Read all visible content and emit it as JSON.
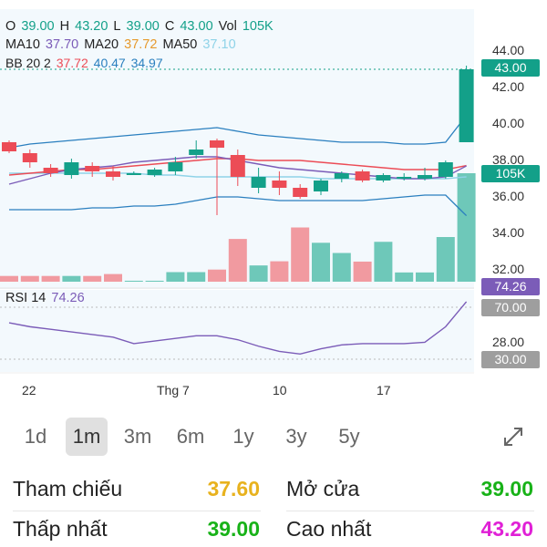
{
  "legend": {
    "ohlc": [
      {
        "k": "O",
        "v": "39.00"
      },
      {
        "k": "H",
        "v": "43.20"
      },
      {
        "k": "L",
        "v": "39.00"
      },
      {
        "k": "C",
        "v": "43.00"
      },
      {
        "k": "Vol",
        "v": "105K"
      }
    ],
    "ma": [
      {
        "k": "MA10",
        "v": "37.70",
        "color": "#7b5cb8"
      },
      {
        "k": "MA20",
        "v": "37.72",
        "color": "#e69a2e"
      },
      {
        "k": "MA50",
        "v": "37.10",
        "color": "#8fd3e8"
      }
    ],
    "bb": {
      "k": "BB 20 2",
      "v1": "37.72",
      "v2": "40.47",
      "v3": "34.97"
    },
    "rsi": {
      "k": "RSI 14",
      "v": "74.26"
    }
  },
  "price_axis": [
    "44.00",
    "42.00",
    "40.00",
    "38.00",
    "36.00",
    "34.00",
    "32.00",
    "30.00",
    "28.00"
  ],
  "badges": {
    "last_price": "43.00",
    "volume": "105K",
    "rsi": "74.26",
    "rsi_upper": "70.00",
    "rsi_lower": "30.00"
  },
  "x_axis": [
    "22",
    "Thg 7",
    "10",
    "17"
  ],
  "timeframes": [
    "1d",
    "1m",
    "3m",
    "6m",
    "1y",
    "3y",
    "5y"
  ],
  "active_timeframe": "1m",
  "stats": {
    "ref_label": "Tham chiếu",
    "ref_value": "37.60",
    "open_label": "Mở cửa",
    "open_value": "39.00",
    "low_label": "Thấp nhất",
    "low_value": "39.00",
    "high_label": "Cao nhất",
    "high_value": "43.20"
  },
  "colors": {
    "up": "#13a089",
    "down": "#ec4c56",
    "ref": "#e8b21e",
    "open": "#18b218",
    "low": "#18b218",
    "high": "#e020d6",
    "rsi": "#7b5cb8",
    "price_badge": "#13a089"
  },
  "icons": {
    "expand": "expand-arrows-icon"
  },
  "chart_data": {
    "type": "candlestick",
    "candles": [
      {
        "o": 39.0,
        "h": 39.1,
        "l": 38.4,
        "c": 38.5
      },
      {
        "o": 38.4,
        "h": 38.6,
        "l": 37.6,
        "c": 37.9
      },
      {
        "o": 37.6,
        "h": 37.8,
        "l": 37.1,
        "c": 37.3
      },
      {
        "o": 37.2,
        "h": 38.1,
        "l": 37.0,
        "c": 37.9
      },
      {
        "o": 37.7,
        "h": 37.9,
        "l": 37.1,
        "c": 37.4
      },
      {
        "o": 37.4,
        "h": 37.7,
        "l": 36.9,
        "c": 37.1
      },
      {
        "o": 37.3,
        "h": 37.4,
        "l": 37.2,
        "c": 37.3
      },
      {
        "o": 37.2,
        "h": 37.6,
        "l": 37.1,
        "c": 37.5
      },
      {
        "o": 37.4,
        "h": 38.2,
        "l": 37.2,
        "c": 37.9
      },
      {
        "o": 38.3,
        "h": 39.1,
        "l": 38.1,
        "c": 38.6
      },
      {
        "o": 39.1,
        "h": 39.2,
        "l": 35.0,
        "c": 38.7
      },
      {
        "o": 38.3,
        "h": 38.6,
        "l": 36.6,
        "c": 37.1
      },
      {
        "o": 36.5,
        "h": 37.6,
        "l": 36.2,
        "c": 37.1
      },
      {
        "o": 36.9,
        "h": 37.4,
        "l": 36.1,
        "c": 36.5
      },
      {
        "o": 36.5,
        "h": 36.7,
        "l": 35.9,
        "c": 36.0
      },
      {
        "o": 36.3,
        "h": 37.0,
        "l": 36.1,
        "c": 36.9
      },
      {
        "o": 37.0,
        "h": 37.4,
        "l": 36.8,
        "c": 37.3
      },
      {
        "o": 37.4,
        "h": 37.5,
        "l": 36.8,
        "c": 36.9
      },
      {
        "o": 36.9,
        "h": 37.3,
        "l": 36.8,
        "c": 37.2
      },
      {
        "o": 37.0,
        "h": 37.3,
        "l": 36.9,
        "c": 37.1
      },
      {
        "o": 37.0,
        "h": 37.6,
        "l": 36.9,
        "c": 37.2
      },
      {
        "o": 37.1,
        "h": 38.0,
        "l": 37.0,
        "c": 37.9
      },
      {
        "o": 39.0,
        "h": 43.2,
        "l": 39.0,
        "c": 43.0
      }
    ],
    "volume": [
      18,
      18,
      18,
      18,
      18,
      24,
      3,
      3,
      30,
      30,
      38,
      134,
      51,
      64,
      170,
      122,
      90,
      63,
      125,
      29,
      29,
      140,
      340
    ],
    "ma10": [
      36.7,
      37.0,
      37.3,
      37.5,
      37.6,
      37.7,
      37.9,
      38.0,
      38.1,
      38.2,
      38.2,
      38.0,
      37.8,
      37.6,
      37.5,
      37.4,
      37.3,
      37.2,
      37.1,
      37.0,
      37.0,
      37.1,
      37.7
    ],
    "ma20": [
      37.2,
      37.3,
      37.4,
      37.5,
      37.5,
      37.6,
      37.7,
      37.8,
      37.9,
      38.0,
      38.1,
      38.1,
      38.0,
      38.0,
      38.0,
      37.9,
      37.8,
      37.7,
      37.6,
      37.5,
      37.5,
      37.5,
      37.72
    ],
    "ma50": [
      37.3,
      37.3,
      37.3,
      37.3,
      37.3,
      37.3,
      37.3,
      37.2,
      37.2,
      37.1,
      37.1,
      37.1,
      37.1,
      37.1,
      37.1,
      37.0,
      37.0,
      37.0,
      37.0,
      37.0,
      37.0,
      37.0,
      37.1
    ],
    "bb_upper": [
      38.7,
      38.9,
      39.0,
      39.1,
      39.2,
      39.3,
      39.4,
      39.5,
      39.6,
      39.7,
      39.8,
      39.6,
      39.4,
      39.3,
      39.2,
      39.1,
      39.0,
      39.0,
      39.0,
      38.9,
      38.9,
      39.0,
      40.47
    ],
    "bb_lower": [
      35.3,
      35.3,
      35.3,
      35.3,
      35.4,
      35.4,
      35.5,
      35.5,
      35.6,
      35.8,
      36.0,
      36.0,
      35.9,
      35.8,
      35.8,
      35.8,
      35.8,
      35.8,
      35.9,
      36.0,
      36.1,
      36.1,
      34.97
    ],
    "rsi": [
      58,
      55,
      53,
      51,
      49,
      47,
      42,
      44,
      46,
      48,
      48,
      45,
      40,
      36,
      34,
      38,
      41,
      42,
      42,
      42,
      43,
      55,
      74.26
    ],
    "price_range": [
      28,
      44
    ],
    "rsi_levels": [
      70,
      30
    ],
    "x_ticks": [
      "22",
      "Thg 7",
      "10",
      "17"
    ]
  }
}
